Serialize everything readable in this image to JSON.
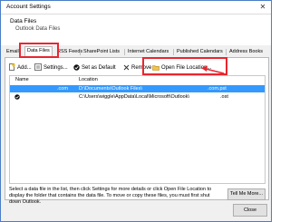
{
  "window": {
    "title": "Account Settings",
    "close_glyph": "✕"
  },
  "header": {
    "section_title": "Data Files",
    "section_subtitle": "Outlook Data Files"
  },
  "tabs": [
    {
      "label": "Email"
    },
    {
      "label": "Data Files",
      "active": true
    },
    {
      "label": "RSS Feeds"
    },
    {
      "label": "SharePoint Lists"
    },
    {
      "label": "Internet Calendars"
    },
    {
      "label": "Published Calendars"
    },
    {
      "label": "Address Books"
    }
  ],
  "toolbar": {
    "add": "Add...",
    "settings": "Settings...",
    "set_default": "Set as Default",
    "remove": "Remove",
    "open_location": "Open File Location..."
  },
  "list": {
    "columns": {
      "name": "Name",
      "location": "Location"
    },
    "rows": [
      {
        "name": ".com",
        "location_prefix": "D:\\Documents\\Outlook Files\\",
        "location_suffix": ".com.pst",
        "selected": true,
        "default": false
      },
      {
        "name": "",
        "location_prefix": "C:\\Users\\wiggle\\AppData\\Local\\Microsoft\\Outlook\\",
        "location_suffix": ".ost",
        "selected": false,
        "default": true
      }
    ]
  },
  "description": "Select a data file in the list, then click Settings for more details or click Open File Location to display the folder that contains the data file. To move or copy these files, you must first shut down Outlook.",
  "buttons": {
    "tell_me_more": "Tell Me More...",
    "close": "Close"
  },
  "colors": {
    "highlight": "#e8262f",
    "selection": "#3399ff",
    "window_border": "#4a7ec7"
  }
}
